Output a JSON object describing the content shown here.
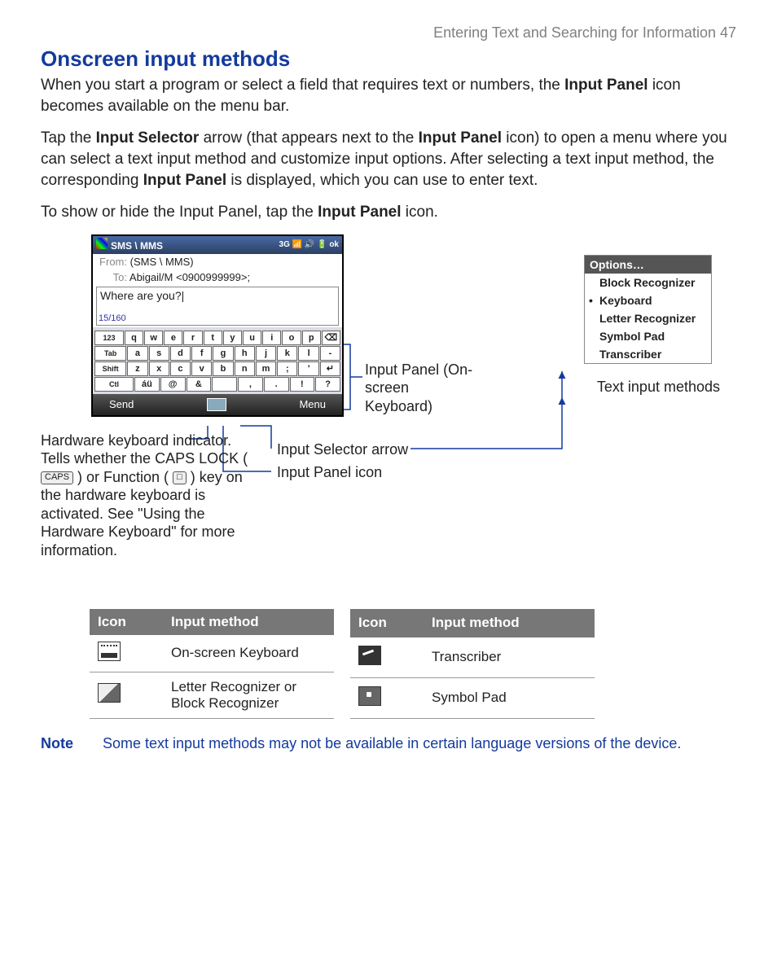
{
  "page": {
    "running_head": "Entering Text and Searching for Information  47",
    "section_title": "Onscreen input methods",
    "para1_a": "When you start a program or select a field that requires text or numbers, the ",
    "para1_b": "Input Panel",
    "para1_c": " icon becomes available on the menu bar.",
    "para2_a": "Tap the ",
    "para2_b": "Input Selector",
    "para2_c": " arrow (that appears next to the ",
    "para2_d": "Input Panel",
    "para2_e": " icon) to open a menu where you can select a text input method and customize input options. After selecting a text input method, the corresponding ",
    "para2_f": "Input Panel",
    "para2_g": " is displayed, which you can use to enter text.",
    "para3_a": "To show or hide the Input Panel, tap the ",
    "para3_b": "Input Panel",
    "para3_c": " icon."
  },
  "phone": {
    "title": "SMS \\ MMS",
    "status": "3G  📶 🔊 🔋  ok",
    "from_label": "From:",
    "from_value": "(SMS \\ MMS)",
    "to_label": "To:",
    "to_value": "Abigail/M  <0900999999>;",
    "body": "Where are you?",
    "count": "15/160",
    "soft_left": "Send",
    "soft_right": "Menu",
    "rows": [
      [
        "123",
        "q",
        "w",
        "e",
        "r",
        "t",
        "y",
        "u",
        "i",
        "o",
        "p",
        "⌫"
      ],
      [
        "Tab",
        "a",
        "s",
        "d",
        "f",
        "g",
        "h",
        "j",
        "k",
        "l",
        "-"
      ],
      [
        "Shift",
        "z",
        "x",
        "c",
        "v",
        "b",
        "n",
        "m",
        ";",
        "'",
        "↵"
      ],
      [
        "Ctl",
        "áü",
        "@",
        "&",
        " ",
        ",",
        ".",
        "!",
        "?"
      ]
    ]
  },
  "options_menu": {
    "header": "Options…",
    "items": [
      "Block Recognizer",
      "Keyboard",
      "Letter Recognizer",
      "Symbol Pad",
      "Transcriber"
    ],
    "selected_index": 1
  },
  "callouts": {
    "hw_kbd_1": "Hardware keyboard indicator. Tells whether the CAPS LOCK (",
    "hw_kbd_caps": "CAPS",
    "hw_kbd_2": ") or Function (",
    "hw_kbd_fn": "□",
    "hw_kbd_3": ") key on the hardware keyboard is activated. See \"Using the Hardware Keyboard\" for more information.",
    "input_panel": "Input Panel (On-screen Keyboard)",
    "text_methods": "Text input methods",
    "selector_arrow": "Input Selector arrow",
    "panel_icon": "Input Panel icon"
  },
  "tables": {
    "col_icon": "Icon",
    "col_method": "Input method",
    "left": [
      {
        "icon": "kbd",
        "label": "On-screen Keyboard"
      },
      {
        "icon": "pen",
        "label": "Letter Recognizer or Block Recognizer"
      }
    ],
    "right": [
      {
        "icon": "scr",
        "label": "Transcriber"
      },
      {
        "icon": "sym",
        "label": "Symbol Pad"
      }
    ]
  },
  "note": {
    "label": "Note",
    "text": "Some text input methods may not be available in certain language versions of the device."
  }
}
